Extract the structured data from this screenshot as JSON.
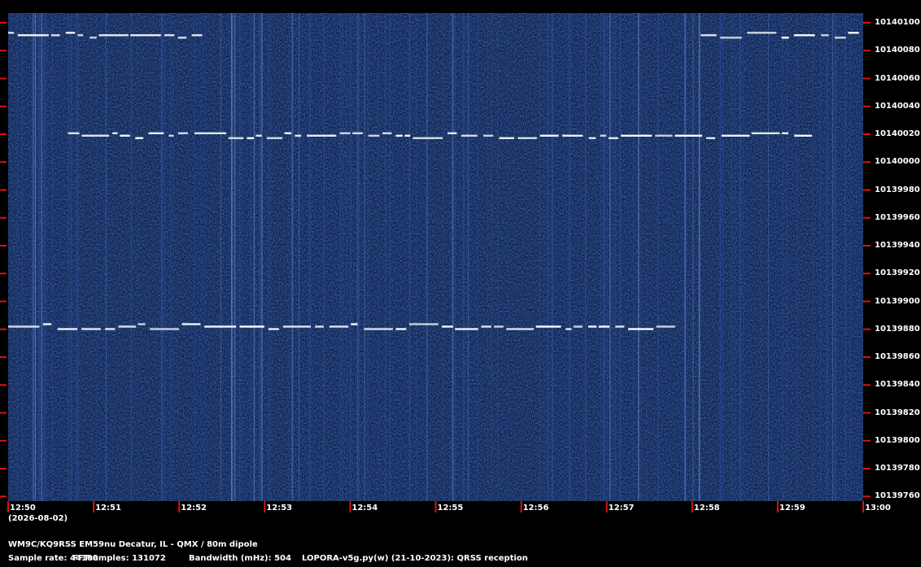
{
  "chart_data": {
    "type": "heatmap",
    "title": "WM9C/KQ9RSS EM59nu Decatur, IL - QMX / 80m dipole",
    "y_ticks": [
      "10140100",
      "10140080",
      "10140060",
      "10140040",
      "10140020",
      "10140000",
      "10139980",
      "10139960",
      "10139940",
      "10139920",
      "10139900",
      "10139880",
      "10139860",
      "10139840",
      "10139820",
      "10139800",
      "10139780",
      "10139760"
    ],
    "x_ticks": [
      "12:50",
      "12:51",
      "12:52",
      "12:53",
      "12:54",
      "12:55",
      "12:56",
      "12:57",
      "12:58",
      "12:59",
      "13:00"
    ],
    "date_label": "(2026-08-02)",
    "ylim": [
      10139760,
      10140100
    ],
    "xlim": [
      "12:50",
      "13:00"
    ],
    "signals": [
      {
        "name": "",
        "freq_hz": 10140079,
        "start": "12:50",
        "end": "12:52.3"
      },
      {
        "name": "",
        "freq_hz": 10140079,
        "start": "12:58.1",
        "end": "13:00"
      },
      {
        "name": "",
        "freq_hz": 10140009,
        "start": "12:50.7",
        "end": "12:59.4"
      },
      {
        "name": "",
        "freq_hz": 10139876,
        "start": "12:50",
        "end": "12:57.8"
      }
    ]
  },
  "footer": {
    "station": "WM9C/KQ9RSS EM59nu Decatur, IL - QMX / 80m dipole",
    "sample_rate": "Sample rate: 44100",
    "fft_samples": "FFTsamples: 131072",
    "bandwidth": "Bandwidth (mHz): 504",
    "software": "LOPORA-v5g.py(w) (21-10-2023): QRSS reception"
  },
  "colors": {
    "background": "#0c2455",
    "signal": "#ffffff",
    "tick": "#dd1111"
  }
}
